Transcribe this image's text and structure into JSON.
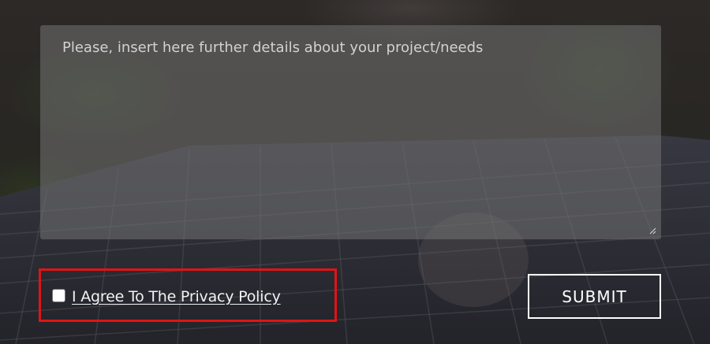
{
  "form": {
    "details_placeholder": "Please, insert here further details about your project/needs",
    "details_value": "",
    "privacy_checkbox_checked": false,
    "privacy_label": "I Agree To The Privacy Policy",
    "submit_label": "SUBMIT"
  },
  "colors": {
    "highlight_border": "#e01414",
    "submit_border": "#ffffff",
    "textarea_bg": "#737373"
  },
  "icons": {
    "resize_handle": "resize-handle-icon"
  }
}
